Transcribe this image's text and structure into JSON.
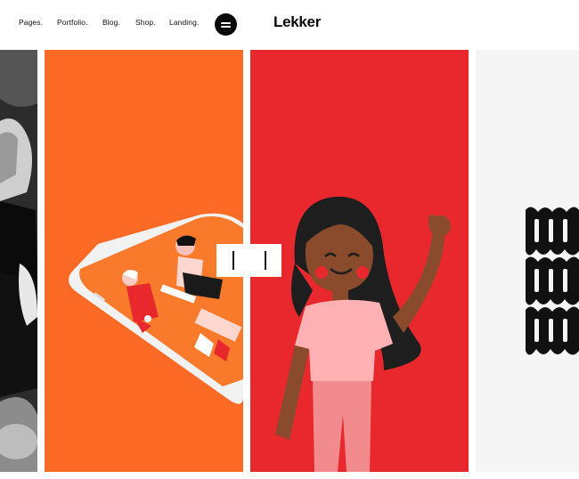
{
  "header": {
    "nav": [
      {
        "label": "."
      },
      {
        "label": "Pages."
      },
      {
        "label": "Portfolio."
      },
      {
        "label": "Blog."
      },
      {
        "label": "Shop."
      },
      {
        "label": "Landing."
      }
    ],
    "logo": "Lekker",
    "menu_icon": "hamburger-menu-icon"
  },
  "slider": {
    "slides": [
      {
        "name": "black-and-white-portrait",
        "color": "#2a2a2a"
      },
      {
        "name": "orange-phone-illustration",
        "color": "#fd6a25"
      },
      {
        "name": "red-girl-illustration",
        "color": "#e8282d"
      },
      {
        "name": "black-pattern-artwork",
        "color": "#f5f5f5"
      }
    ],
    "prev_icon": "prev-arrow-icon",
    "next_icon": "next-arrow-icon"
  }
}
